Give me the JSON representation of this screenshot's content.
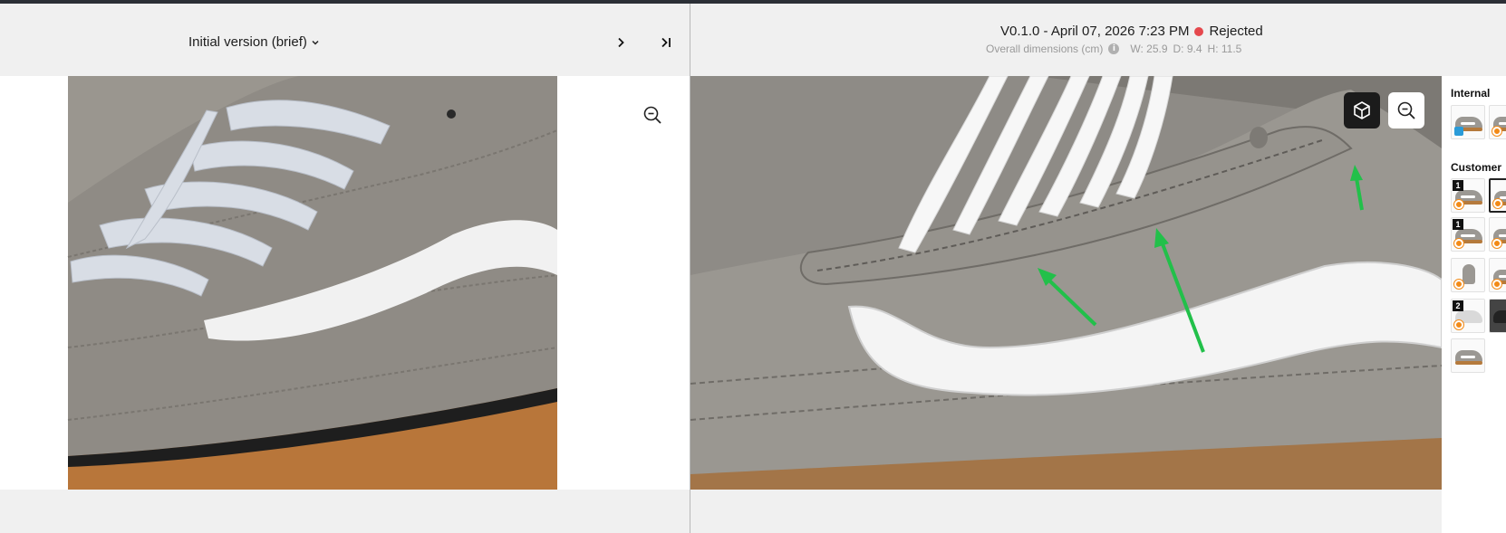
{
  "left": {
    "version_label": "Initial version (brief)",
    "icons": {
      "dropdown": "chevron-down-icon",
      "next": "chevron-right-icon",
      "last": "skip-to-end-icon",
      "zoom": "zoom-out-icon"
    }
  },
  "right": {
    "version_title": "V0.1.0 - April 07, 2026 7:23 PM",
    "status": "Rejected",
    "status_color": "#e5484d",
    "dimensions_label": "Overall dimensions (cm)",
    "dim_w": "W: 25.9",
    "dim_d": "D: 9.4",
    "dim_h": "H: 11.5",
    "icons": {
      "view_3d": "cube-icon",
      "zoom": "zoom-out-icon",
      "info": "info-icon"
    }
  },
  "sidebar": {
    "internal_label": "Internal",
    "customer_label": "Customer",
    "internal_thumbs": [
      {
        "badge": "",
        "type": "doc"
      },
      {
        "badge": "",
        "type": "blender"
      }
    ],
    "customer_thumbs": [
      {
        "badge": "1",
        "type": "blender"
      },
      {
        "badge": "",
        "type": "blender",
        "selected": true
      },
      {
        "badge": "1",
        "type": "blender"
      },
      {
        "badge": "",
        "type": "blender"
      },
      {
        "badge": "",
        "type": "blender"
      },
      {
        "badge": "",
        "type": "blender"
      },
      {
        "badge": "2",
        "type": "blender"
      },
      {
        "badge": "",
        "type": "plain"
      },
      {
        "badge": "",
        "type": "plain"
      }
    ]
  },
  "colors": {
    "annotation_arrow": "#22c04a",
    "gum_sole": "#b8763a",
    "suede": "#9a9690"
  }
}
